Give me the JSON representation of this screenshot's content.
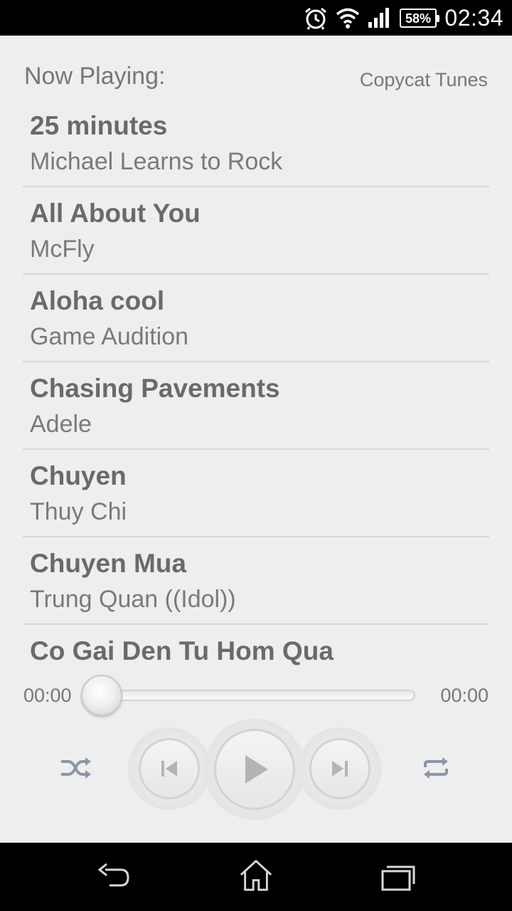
{
  "status_bar": {
    "time": "02:34",
    "battery": "58%",
    "icons": [
      "alarm-icon",
      "wifi-icon",
      "signal-icon",
      "battery-icon"
    ]
  },
  "header": {
    "title": "Now Playing:",
    "app_name": "Copycat Tunes"
  },
  "tracks": [
    {
      "title": "25 minutes",
      "artist": "Michael Learns to Rock"
    },
    {
      "title": "All About You",
      "artist": "McFly"
    },
    {
      "title": "Aloha cool",
      "artist": "Game Audition"
    },
    {
      "title": "Chasing Pavements",
      "artist": "Adele"
    },
    {
      "title": "Chuyen",
      "artist": "Thuy Chi"
    },
    {
      "title": "Chuyen Mua",
      "artist": "Trung Quan ((Idol))"
    },
    {
      "title": "Co Gai Den Tu Hom Qua",
      "artist": ""
    }
  ],
  "player": {
    "elapsed": "00:00",
    "duration": "00:00",
    "progress": 0,
    "controls": [
      "shuffle-icon",
      "previous-icon",
      "play-icon",
      "next-icon",
      "repeat-icon"
    ]
  },
  "nav_bar": {
    "icons": [
      "back-icon",
      "home-icon",
      "recent-apps-icon"
    ]
  },
  "colors": {
    "background": "#eeeeee",
    "text_primary": "#6a6a6a",
    "text_secondary": "#7a7a7a",
    "icon": "#8a96a8",
    "bars": "#000000"
  }
}
